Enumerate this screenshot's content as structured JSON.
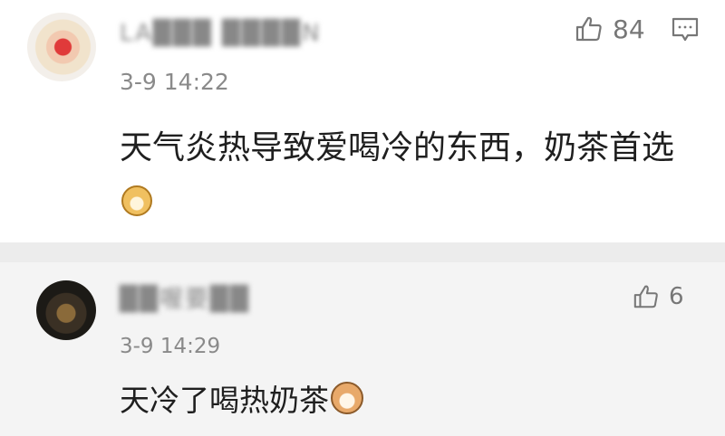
{
  "comments": [
    {
      "username": "LA███ ████N",
      "timestamp": "3-9 14:22",
      "text": "天气炎热导致爱喝冷的东西，奶茶首选",
      "emoji": "doge-emoji",
      "likes": "84",
      "has_reply_icon": true
    },
    {
      "username": "██喔要██",
      "timestamp": "3-9 14:29",
      "text": "天冷了喝热奶茶",
      "emoji": "cat-emoji",
      "likes": "6",
      "has_reply_icon": false
    }
  ],
  "icons": {
    "like": "thumbs-up-icon",
    "reply": "comment-reply-icon"
  },
  "colors": {
    "background": "#ffffff",
    "reply_background": "#f4f4f4",
    "separator": "#ececec",
    "meta_text": "#8a8a8a",
    "body_text": "#1f1f1f"
  }
}
